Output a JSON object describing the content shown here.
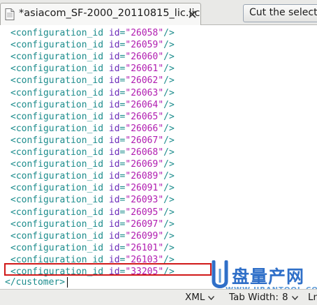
{
  "tab": {
    "title": "*asiacom_SF-2000_20110815_lic.lic"
  },
  "toolbar": {
    "cut_label": "Cut the selection"
  },
  "code": {
    "tag_open": "<configuration_id",
    "attr_name": "id",
    "equals": "=",
    "tag_close": "/>",
    "ids": [
      "26058",
      "26059",
      "26060",
      "26061",
      "26062",
      "26063",
      "26064",
      "26065",
      "26066",
      "26067",
      "26068",
      "26069",
      "26089",
      "26091",
      "26093",
      "26095",
      "26097",
      "26099",
      "26101",
      "26103",
      "33205"
    ],
    "closing_tag": "</customer>"
  },
  "statusbar": {
    "language": "XML",
    "tab_width_label": "Tab Width:",
    "tab_width_value": "8",
    "position_prefix": "Ln"
  },
  "watermark": {
    "title": "盘量产网",
    "url": "WWW.URANTOOL.COM"
  },
  "colors": {
    "tag": "#1c8c8c",
    "attribute": "#6a2ab8",
    "value": "#b01cb0",
    "highlight": "#d01818",
    "watermark": "#2f6fc8"
  }
}
